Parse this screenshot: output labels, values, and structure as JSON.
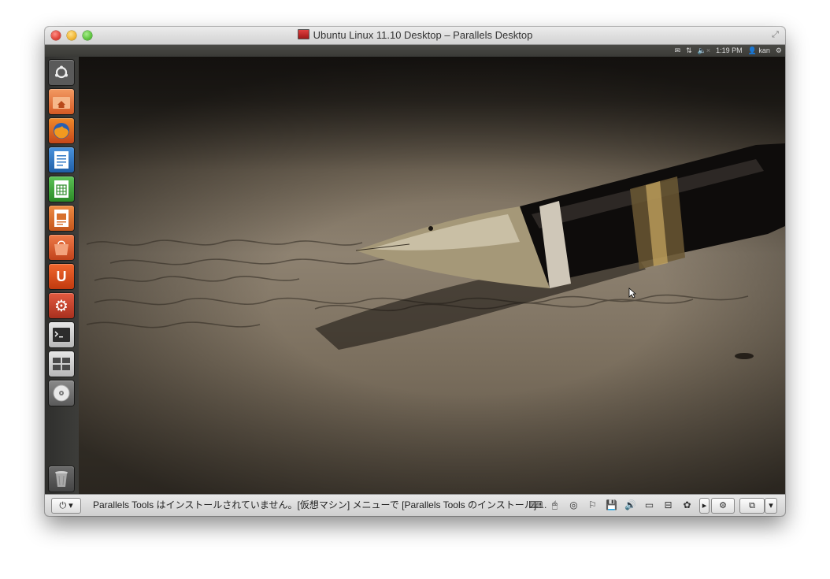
{
  "window": {
    "title": "Ubuntu Linux 11.10 Desktop – Parallels Desktop"
  },
  "topbar": {
    "time": "1:19 PM",
    "user": "kan"
  },
  "launcher": {
    "items": [
      {
        "name": "dash-home",
        "icon": "ubuntu-logo-icon",
        "color": "#5a5a5a"
      },
      {
        "name": "home-folder",
        "icon": "home-folder-icon",
        "color": "#e9733a"
      },
      {
        "name": "firefox",
        "icon": "firefox-icon",
        "color": "#d8651f"
      },
      {
        "name": "libreoffice-writer",
        "icon": "writer-icon",
        "color": "#2f77c4"
      },
      {
        "name": "libreoffice-calc",
        "icon": "calc-icon",
        "color": "#3ea53a"
      },
      {
        "name": "libreoffice-impress",
        "icon": "impress-icon",
        "color": "#d8702c"
      },
      {
        "name": "software-center",
        "icon": "software-center-icon",
        "color": "#d95a2b"
      },
      {
        "name": "ubuntu-one",
        "icon": "ubuntu-one-icon",
        "color": "#dd4814"
      },
      {
        "name": "system-settings",
        "icon": "settings-gears-icon",
        "color": "#c8412c"
      },
      {
        "name": "terminal",
        "icon": "terminal-icon",
        "color": "#4a4a4a"
      },
      {
        "name": "workspace-switcher",
        "icon": "workspace-switcher-icon",
        "color": "#5c5c5c"
      },
      {
        "name": "cd-drive",
        "icon": "cd-disc-icon",
        "color": "#6a6a6a"
      },
      {
        "name": "trash",
        "icon": "trash-icon",
        "color": "#555555"
      }
    ]
  },
  "statusbar": {
    "power_label": "⏻ ▾",
    "message": "Parallels Tools はインストールされていません。[仮想マシン] メニューで [Parallels Tools のインストール] ..."
  }
}
